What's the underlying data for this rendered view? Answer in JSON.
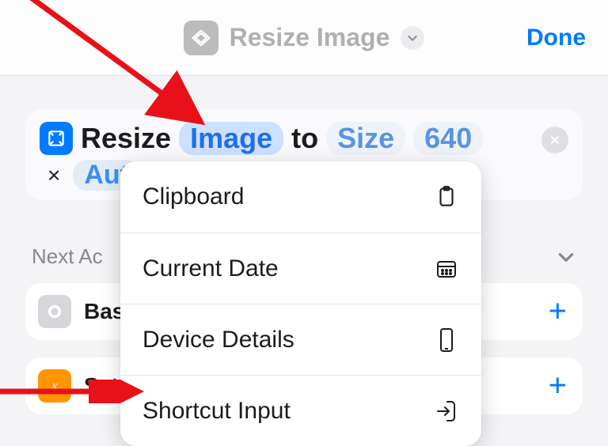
{
  "header": {
    "title": "Resize Image",
    "done": "Done"
  },
  "action": {
    "verb": "Resize",
    "image_token": "Image",
    "to": "to",
    "size_token": "Size",
    "value": "640",
    "x": "×",
    "auto_partial": "Aut"
  },
  "section": {
    "title": "Next Ac"
  },
  "suggestions": [
    {
      "label": "Bas"
    },
    {
      "label": "Set"
    }
  ],
  "menu": {
    "items": [
      {
        "label": "Clipboard"
      },
      {
        "label": "Current Date"
      },
      {
        "label": "Device Details"
      },
      {
        "label": "Shortcut Input"
      }
    ]
  }
}
